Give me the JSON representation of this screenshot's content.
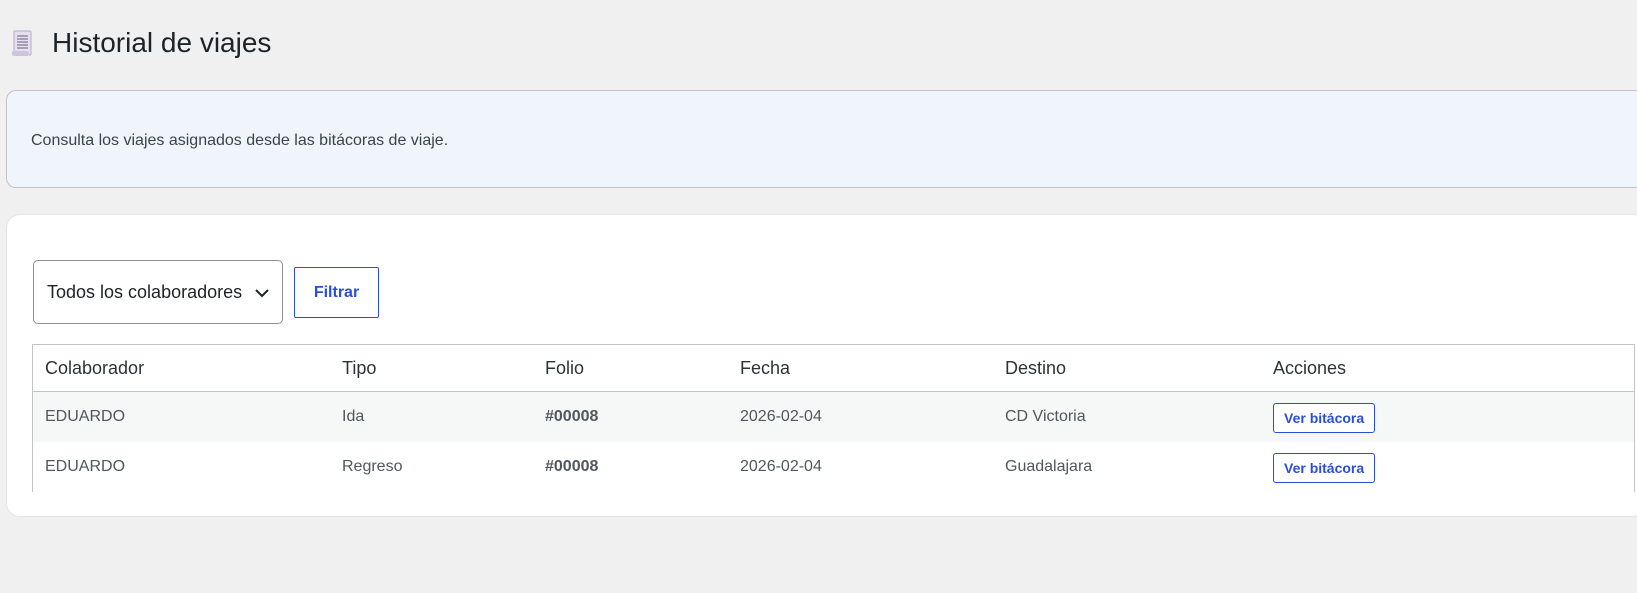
{
  "header": {
    "icon": "document-icon",
    "title": "Historial de viajes"
  },
  "notice": {
    "text": "Consulta los viajes asignados desde las bitácoras de viaje."
  },
  "filters": {
    "collaborator_select": {
      "selected": "Todos los colaboradores"
    },
    "filter_button": "Filtrar"
  },
  "table": {
    "headers": {
      "colaborador": "Colaborador",
      "tipo": "Tipo",
      "folio": "Folio",
      "fecha": "Fecha",
      "destino": "Destino",
      "acciones": "Acciones"
    },
    "rows": [
      {
        "colaborador": "EDUARDO",
        "tipo": "Ida",
        "folio": "#00008",
        "fecha": "2026-02-04",
        "destino": "CD Victoria",
        "action": "Ver bitácora"
      },
      {
        "colaborador": "EDUARDO",
        "tipo": "Regreso",
        "folio": "#00008",
        "fecha": "2026-02-04",
        "destino": "Guadalajara",
        "action": "Ver bitácora"
      }
    ]
  },
  "colors": {
    "accent": "#2b4fd4",
    "background": "#f0f0f1",
    "notice_bg": "#f0f5fd"
  }
}
